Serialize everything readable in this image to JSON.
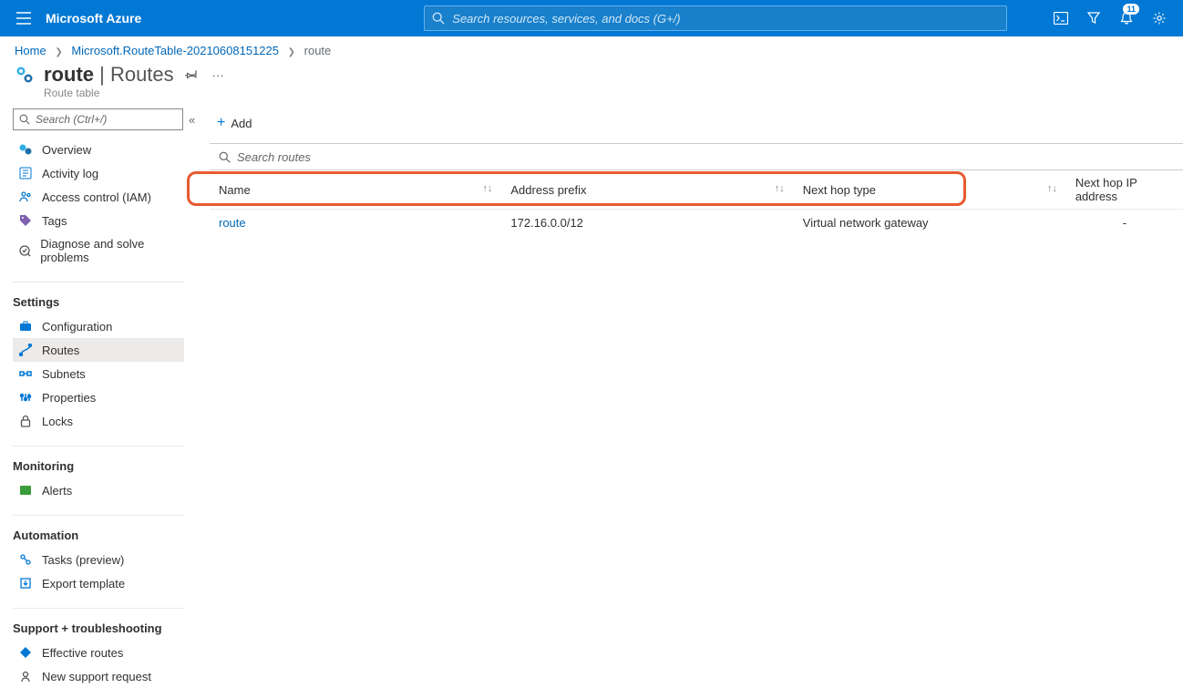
{
  "brand": "Microsoft Azure",
  "search_placeholder": "Search resources, services, and docs (G+/)",
  "notifications_badge": "11",
  "breadcrumb": {
    "home": "Home",
    "item2": "Microsoft.RouteTable-20210608151225",
    "current": "route"
  },
  "page": {
    "title_main": "route",
    "title_sep": " | ",
    "title_sub": "Routes",
    "subtitle": "Route table"
  },
  "side_search_placeholder": "Search (Ctrl+/)",
  "nav": {
    "overview": "Overview",
    "activity_log": "Activity log",
    "iam": "Access control (IAM)",
    "tags": "Tags",
    "diagnose": "Diagnose and solve problems",
    "section_settings": "Settings",
    "configuration": "Configuration",
    "routes": "Routes",
    "subnets": "Subnets",
    "properties": "Properties",
    "locks": "Locks",
    "section_monitoring": "Monitoring",
    "alerts": "Alerts",
    "section_automation": "Automation",
    "tasks": "Tasks (preview)",
    "export_template": "Export template",
    "section_support": "Support + troubleshooting",
    "effective_routes": "Effective routes",
    "new_support": "New support request"
  },
  "toolbar": {
    "add": "Add"
  },
  "routes_search_placeholder": "Search routes",
  "columns": {
    "name": "Name",
    "prefix": "Address prefix",
    "hop_type": "Next hop type",
    "hop_ip": "Next hop IP address"
  },
  "rows": [
    {
      "name": "route",
      "prefix": "172.16.0.0/12",
      "hop_type": "Virtual network gateway",
      "hop_ip": "-"
    }
  ]
}
